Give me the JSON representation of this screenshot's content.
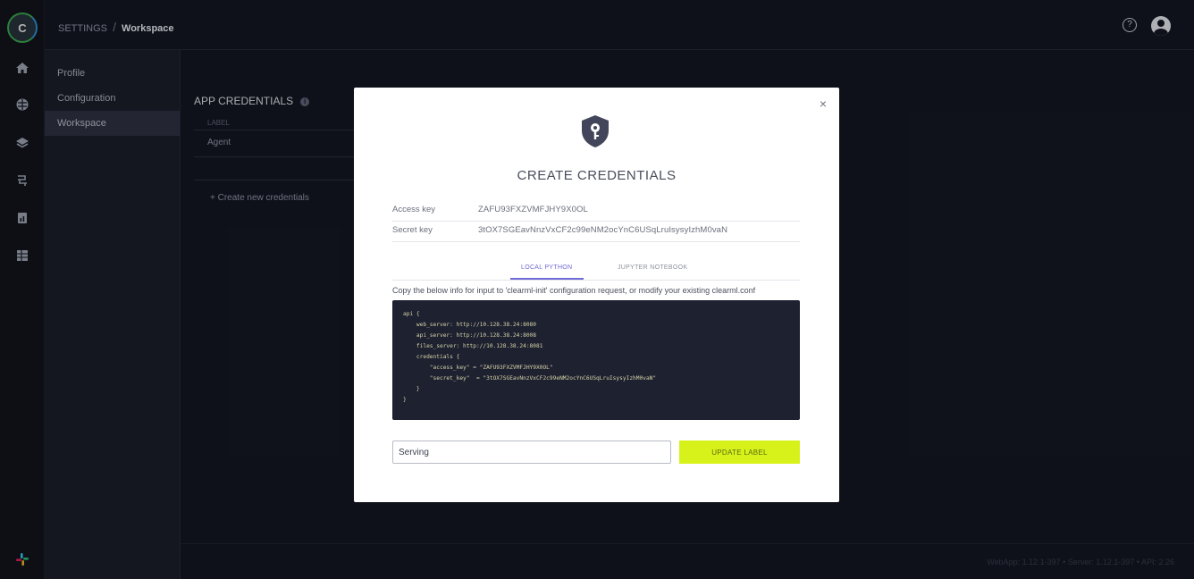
{
  "header": {
    "breadcrumb_root": "SETTINGS",
    "breadcrumb_sep": "/",
    "breadcrumb_current": "Workspace",
    "help_icon": "question-circle-icon",
    "avatar_icon": "user-avatar-icon"
  },
  "rail": {
    "logo_letter": "C",
    "icons": [
      "home-icon",
      "brain-icon",
      "layers-icon",
      "pipelines-icon",
      "reports-icon",
      "datasets-icon"
    ],
    "bottom_icon": "slack-icon"
  },
  "subnav": {
    "items": [
      {
        "label": "Profile"
      },
      {
        "label": "Configuration"
      },
      {
        "label": "Workspace"
      }
    ]
  },
  "main": {
    "section_title": "APP CREDENTIALS",
    "table_header_label": "LABEL",
    "table_row_label": "Agent",
    "create_new": "+ Create new credentials"
  },
  "footer": {
    "version": "WebApp: 1.12.1-397 • Server: 1.12.1-397 • API: 2.26"
  },
  "modal": {
    "title": "CREATE CREDENTIALS",
    "close": "×",
    "access_key_label": "Access key",
    "access_key_value": "ZAFU93FXZVMFJHY9X0OL",
    "secret_key_label": "Secret key",
    "secret_key_value": "3tOX7SGEavNnzVxCF2c99eNM2ocYnC6USqLruIsysyIzhM0vaN",
    "tabs": [
      {
        "label": "LOCAL PYTHON",
        "active": true
      },
      {
        "label": "JUPYTER NOTEBOOK",
        "active": false
      }
    ],
    "description": "Copy the below info for input to 'clearml-init' configuration request, or modify your existing clearml.conf",
    "code": "api {\n    web_server: http://10.128.38.24:8080\n    api_server: http://10.128.38.24:8008\n    files_server: http://10.128.38.24:8081\n    credentials {\n        \"access_key\" = \"ZAFU93FXZVMFJHY9X0OL\"\n        \"secret_key\"  = \"3tOX7SGEavNnzVxCF2c99eNM2ocYnC6USqLruIsysyIzhM0vaN\"\n    }\n}",
    "label_input_value": "Serving",
    "update_button": "UPDATE LABEL"
  },
  "colors": {
    "accent_button": "#d6f21a",
    "tab_active": "#6f6ad6",
    "code_background": "#1d2130",
    "sidebar_background": "#1b1e29"
  }
}
